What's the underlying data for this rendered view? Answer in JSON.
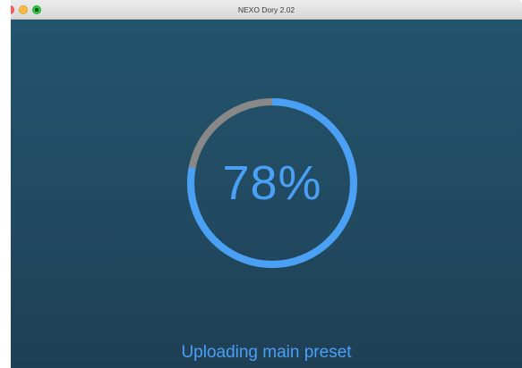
{
  "window": {
    "title": "NEXO Dory 2.02"
  },
  "progress": {
    "label": "78%",
    "fraction": 0.78,
    "fill_color": "#4aa0f5",
    "track_color": "#888888"
  },
  "status": {
    "text": "Uploading main preset"
  },
  "colors": {
    "background_top": "#22546d",
    "background_bottom": "#1f3f54",
    "accent": "#4aa0f5"
  }
}
